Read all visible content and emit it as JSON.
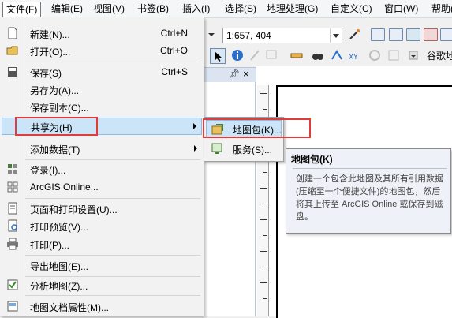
{
  "menubar": {
    "items": [
      "文件(F)",
      "编辑(E)",
      "视图(V)",
      "书签(B)",
      "插入(I)",
      "选择(S)",
      "地理处理(G)",
      "自定义(C)",
      "窗口(W)",
      "帮助("
    ]
  },
  "toolbar": {
    "scale_value": "1:657, 404",
    "gd_label": "谷歌地"
  },
  "file_menu": {
    "items": [
      {
        "label": "新建(N)...",
        "shortcut": "Ctrl+N"
      },
      {
        "label": "打开(O)...",
        "shortcut": "Ctrl+O"
      },
      {
        "label": "保存(S)",
        "shortcut": "Ctrl+S"
      },
      {
        "label": "另存为(A)...",
        "shortcut": ""
      },
      {
        "label": "保存副本(C)...",
        "shortcut": ""
      },
      {
        "label": "共享为(H)",
        "shortcut": ""
      },
      {
        "label": "添加数据(T)",
        "shortcut": ""
      },
      {
        "label": "登录(I)...",
        "shortcut": ""
      },
      {
        "label": "ArcGIS Online...",
        "shortcut": ""
      },
      {
        "label": "页面和打印设置(U)...",
        "shortcut": ""
      },
      {
        "label": "打印预览(V)...",
        "shortcut": ""
      },
      {
        "label": "打印(P)...",
        "shortcut": ""
      },
      {
        "label": "导出地图(E)...",
        "shortcut": ""
      },
      {
        "label": "分析地图(Z)...",
        "shortcut": ""
      },
      {
        "label": "地图文档属性(M)...",
        "shortcut": ""
      }
    ]
  },
  "share_submenu": {
    "items": [
      {
        "label": "地图包(K)..."
      },
      {
        "label": "服务(S)..."
      }
    ]
  },
  "tooltip": {
    "title": "地图包(K)",
    "description": "创建一个包含此地图及其所有引用数据(压缩至一个便捷文件)的地图包，然后将其上传至 ArcGIS Online 或保存到磁盘。"
  },
  "colors": {
    "highlight": "#cce4f7",
    "annotation_red": "#e03c3c",
    "menu_bg": "#f2f2f2"
  }
}
